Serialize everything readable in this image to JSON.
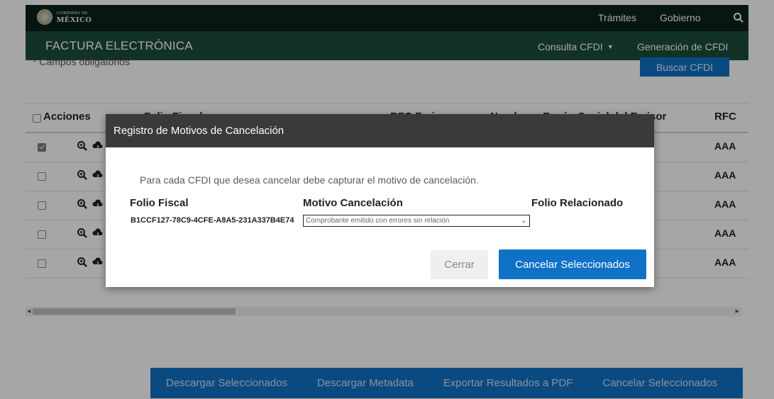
{
  "header": {
    "logo_small": "GOBIERNO DE",
    "logo_big": "MÉXICO",
    "links": [
      "Trámites",
      "Gobierno"
    ]
  },
  "subheader": {
    "brand": "FACTURA ELECTRÓNICA",
    "links": [
      "Consulta CFDI",
      "Generación de CFDI"
    ]
  },
  "form": {
    "required_note": "* Campos obligatorios",
    "search_button": "Buscar CFDI"
  },
  "table": {
    "headers": [
      "Acciones",
      "Folio Fiscal",
      "RFC Emisor",
      "Nombre o Razón Social del Emisor",
      "RFC"
    ],
    "rows": [
      {
        "checked": true,
        "rfc": "AAA"
      },
      {
        "checked": false,
        "rfc": "AAA"
      },
      {
        "checked": false,
        "rfc": "AAA"
      },
      {
        "checked": false,
        "rfc": "AAA"
      },
      {
        "checked": false,
        "rfc": "AAA"
      }
    ]
  },
  "bottom_actions": [
    "Descargar Seleccionados",
    "Descargar Metadata",
    "Exportar Resultados a PDF",
    "Cancelar Seleccionados"
  ],
  "modal": {
    "title": "Registro de Motivos de Cancelación",
    "intro": "Para cada CFDI que desea cancelar debe capturar el motivo de cancelación.",
    "col_folio": "Folio Fiscal",
    "col_motivo": "Motivo Cancelación",
    "col_relacionado": "Folio Relacionado",
    "folio_value": "B1CCF127-78C9-4CFE-A8A5-231A337B4E74",
    "motivo_selected": "Comprobante emitido con errores sin relación",
    "close_button": "Cerrar",
    "cancel_button": "Cancelar Seleccionados"
  },
  "colors": {
    "header_bg": "#0c2319",
    "subheader_bg": "#1d4d3a",
    "primary": "#1072c6"
  }
}
